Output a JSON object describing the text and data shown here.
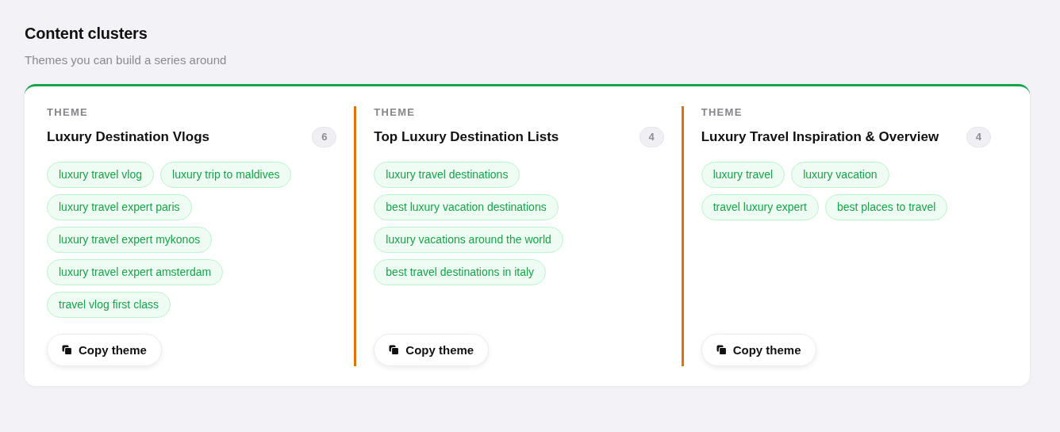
{
  "header": {
    "title": "Content clusters",
    "subtitle": "Themes you can build a series around"
  },
  "themes": [
    {
      "label": "THEME",
      "title": "Luxury Destination Vlogs",
      "count": "6",
      "keywords": [
        "luxury travel vlog",
        "luxury trip to maldives",
        "luxury travel expert paris",
        "luxury travel expert mykonos",
        "luxury travel expert amsterdam",
        "travel vlog first class"
      ],
      "button": "Copy theme"
    },
    {
      "label": "THEME",
      "title": "Top Luxury Destination Lists",
      "count": "4",
      "keywords": [
        "luxury travel destinations",
        "best luxury vacation destinations",
        "luxury vacations around the world",
        "best travel destinations in italy"
      ],
      "button": "Copy theme"
    },
    {
      "label": "THEME",
      "title": "Luxury Travel Inspiration & Overview",
      "count": "4",
      "keywords": [
        "luxury travel",
        "luxury vacation",
        "travel luxury expert",
        "best places to travel"
      ],
      "button": "Copy theme"
    }
  ]
}
